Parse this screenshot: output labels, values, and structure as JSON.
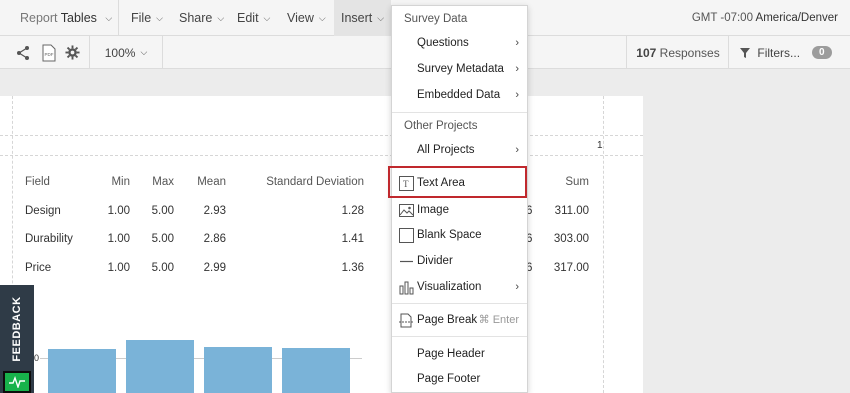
{
  "menubar": {
    "report_prefix": "Report",
    "report_name": "Tables",
    "items": [
      "File",
      "Share",
      "Edit",
      "View",
      "Insert"
    ],
    "timezone_offset": "GMT -07:00",
    "timezone_name": "America/Denver"
  },
  "toolbar": {
    "zoom": "100%",
    "responses_count": "107",
    "responses_label": "Responses",
    "filters_label": "Filters...",
    "filters_count": "0"
  },
  "page": {
    "page_number": "1"
  },
  "table": {
    "headers": {
      "field": "Field",
      "min": "Min",
      "max": "Max",
      "mean": "Mean",
      "std": "Standard Deviation",
      "count_fragment": "",
      "sum": "Sum"
    },
    "rows": [
      {
        "field": "Design",
        "min": "1.00",
        "max": "5.00",
        "mean": "2.93",
        "std": "1.28",
        "cut": "6",
        "sum": "311.00"
      },
      {
        "field": "Durability",
        "min": "1.00",
        "max": "5.00",
        "mean": "2.86",
        "std": "1.41",
        "cut": "6",
        "sum": "303.00"
      },
      {
        "field": "Price",
        "min": "1.00",
        "max": "5.00",
        "mean": "2.99",
        "std": "1.36",
        "cut": "6",
        "sum": "317.00"
      }
    ]
  },
  "chart_data": {
    "type": "bar",
    "categories": [
      "",
      "",
      "",
      ""
    ],
    "values": [
      2.93,
      3.4,
      3.05,
      2.99
    ],
    "visible_tick": "0",
    "title": "",
    "xlabel": "",
    "ylabel": ""
  },
  "feedback": {
    "label": "FEEDBACK"
  },
  "dropdown": {
    "survey_data_header": "Survey Data",
    "questions": "Questions",
    "survey_metadata": "Survey Metadata",
    "embedded_data": "Embedded Data",
    "other_projects_header": "Other Projects",
    "all_projects": "All Projects",
    "text_area": "Text Area",
    "image": "Image",
    "blank_space": "Blank Space",
    "divider": "Divider",
    "visualization": "Visualization",
    "page_break": "Page Break",
    "page_break_shortcut": "⌘ Enter",
    "page_header": "Page Header",
    "page_footer": "Page Footer"
  },
  "colors": {
    "bar": "#7ab3d8",
    "highlight": "#c0282d",
    "feedback_bg": "#2f3b47",
    "pulse_green": "#18b24b"
  }
}
